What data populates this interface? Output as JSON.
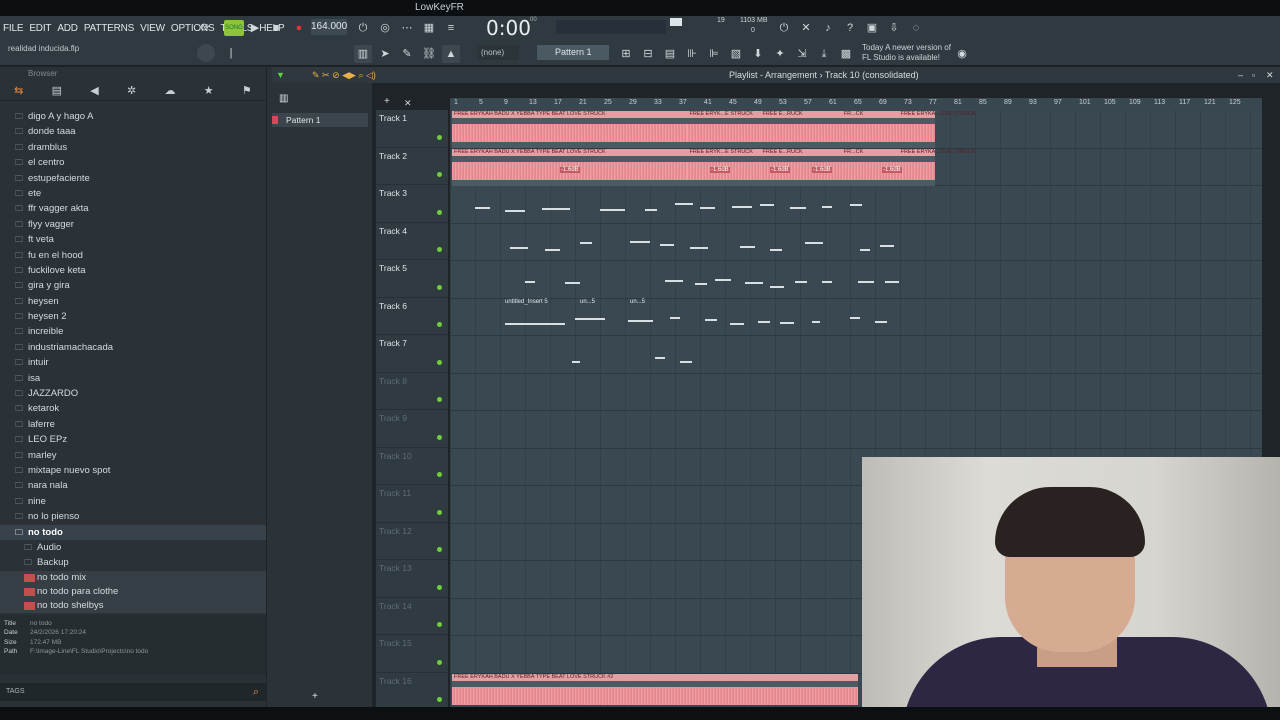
{
  "window": {
    "title": "LowKeyFR"
  },
  "menu": [
    "FILE",
    "EDIT",
    "ADD",
    "PATTERNS",
    "VIEW",
    "OPTIONS",
    "TOOLS",
    "HELP"
  ],
  "transport": {
    "mode": "SONG",
    "tempo": "164.000",
    "time": "0:00",
    "time_small": "00",
    "cpu": "19",
    "mem": "1103 MB",
    "poly": "0"
  },
  "hint_bar": {
    "text": "realidad inducida.flp"
  },
  "pattern_selector": {
    "pattern": "Pattern 1",
    "none": "(none)"
  },
  "news": {
    "line1": "Today  A newer version of",
    "line2": "FL Studio is available!"
  },
  "browser": {
    "header": "Browser",
    "items": [
      {
        "label": "digo A y hago A",
        "type": "folder"
      },
      {
        "label": "donde taaa",
        "type": "folder"
      },
      {
        "label": "dramblus",
        "type": "folder"
      },
      {
        "label": "el centro",
        "type": "folder"
      },
      {
        "label": "estupefaciente",
        "type": "folder"
      },
      {
        "label": "ete",
        "type": "folder"
      },
      {
        "label": "ffr vagger akta",
        "type": "folder"
      },
      {
        "label": "flyy vagger",
        "type": "folder"
      },
      {
        "label": "ft veta",
        "type": "folder"
      },
      {
        "label": "fu en el hood",
        "type": "folder"
      },
      {
        "label": "fuckilove keta",
        "type": "folder"
      },
      {
        "label": "gira y gira",
        "type": "folder"
      },
      {
        "label": "heysen",
        "type": "folder"
      },
      {
        "label": "heysen 2",
        "type": "folder"
      },
      {
        "label": "increible",
        "type": "folder"
      },
      {
        "label": "industriamachacada",
        "type": "folder"
      },
      {
        "label": "intuir",
        "type": "folder"
      },
      {
        "label": "isa",
        "type": "folder"
      },
      {
        "label": "JAZZARDO",
        "type": "folder"
      },
      {
        "label": "ketarok",
        "type": "folder"
      },
      {
        "label": "laferre",
        "type": "folder"
      },
      {
        "label": "LEO EPz",
        "type": "folder"
      },
      {
        "label": "marley",
        "type": "folder"
      },
      {
        "label": "mixtape nuevo spot",
        "type": "folder"
      },
      {
        "label": "nara nala",
        "type": "folder"
      },
      {
        "label": "nine",
        "type": "folder"
      },
      {
        "label": "no lo pienso",
        "type": "folder"
      },
      {
        "label": "no todo",
        "type": "folder-open"
      },
      {
        "label": "Audio",
        "type": "subfolder"
      },
      {
        "label": "Backup",
        "type": "subfolder"
      },
      {
        "label": "no todo mix",
        "type": "file"
      },
      {
        "label": "no todo para clothe",
        "type": "file"
      },
      {
        "label": "no todo shelbys",
        "type": "file"
      }
    ],
    "info": {
      "title_k": "Title",
      "title_v": "no todo",
      "date_k": "Date",
      "date_v": "24/2/2026 17:20:24",
      "size_k": "Size",
      "size_v": "172.47 MB",
      "path_k": "Path",
      "path_v": "F:\\Image-Line\\FL Studio\\Projects\\no todo"
    },
    "tags": "TAGS"
  },
  "picker": {
    "pattern": "Pattern 1"
  },
  "playlist": {
    "title": "Playlist - Arrangement",
    "sep": "›",
    "track_ctx": "Track 10 (consolidated)",
    "ruler": [
      "1",
      "5",
      "9",
      "13",
      "17",
      "21",
      "25",
      "29",
      "33",
      "37",
      "41",
      "45",
      "49",
      "53",
      "57",
      "61",
      "65",
      "69",
      "73",
      "77",
      "81",
      "85",
      "89",
      "93",
      "97",
      "101",
      "105",
      "109",
      "113",
      "117",
      "121",
      "125"
    ],
    "tracks": [
      "Track 1",
      "Track 2",
      "Track 3",
      "Track 4",
      "Track 5",
      "Track 6",
      "Track 7",
      "Track 8",
      "Track 9",
      "Track 10",
      "Track 11",
      "Track 12",
      "Track 13",
      "Track 14",
      "Track 15",
      "Track 16"
    ],
    "clips": [
      {
        "row": 0,
        "start": 0,
        "end": 0.29,
        "label": "FREE ERYKAH BADU X YEBBA TYPE BEAT LOVE STRUCK"
      },
      {
        "row": 0,
        "start": 0.29,
        "end": 0.38,
        "label": "FREE ERYK...E STRUCK"
      },
      {
        "row": 0,
        "start": 0.38,
        "end": 0.48,
        "label": "FREE E...RUCK"
      },
      {
        "row": 0,
        "start": 0.48,
        "end": 0.55,
        "label": "FR...CK"
      },
      {
        "row": 0,
        "start": 0.55,
        "end": 0.595,
        "label": "FREE ERYKA...OVE STRUCK"
      },
      {
        "row": 1,
        "start": 0,
        "end": 0.29,
        "label": "FREE ERYKAH BADU X YEBBA TYPE BEAT LOVE STRUCK"
      },
      {
        "row": 1,
        "start": 0.29,
        "end": 0.38,
        "label": "FREE ERYK...E STRUCK"
      },
      {
        "row": 1,
        "start": 0.38,
        "end": 0.48,
        "label": "FREE E...RUCK"
      },
      {
        "row": 1,
        "start": 0.48,
        "end": 0.55,
        "label": "FR...CK"
      },
      {
        "row": 1,
        "start": 0.55,
        "end": 0.595,
        "label": "FREE ERYKA...OVE STRUCK"
      },
      {
        "row": 15,
        "start": 0,
        "end": 0.5,
        "label": "FREE ERYKAH BADU X YEBBA TYPE BEAT LOVE STRUCK #2"
      }
    ],
    "gain_labels": [
      "-1.6dB",
      "-1.6dB",
      "-1.6dB",
      "-1.6dB",
      "-1.6dB"
    ],
    "t6_labels": [
      "untitled_Insert 5",
      "un...5",
      "un...5"
    ]
  },
  "colors": {
    "accent_green": "#8fc43a",
    "audio_clip": "#e98a90",
    "record": "#e0303a"
  }
}
